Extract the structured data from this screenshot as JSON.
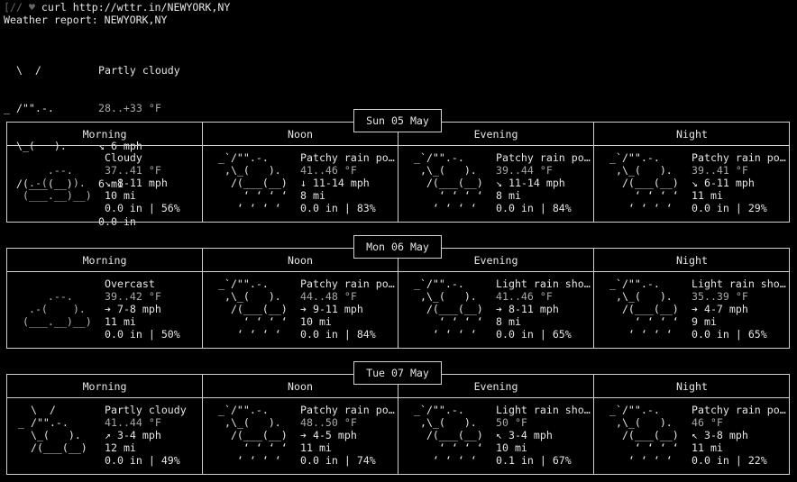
{
  "terminal": {
    "prompt_prefix": "[//",
    "prompt_symbol": "♥",
    "command": "curl http://wttr.in/NEWYORK,NY",
    "report_title": "Weather report: NEWYORK,NY"
  },
  "current": {
    "art": [
      "  \\  /",
      "_ /\"\".-.",
      "  \\_(   ).",
      "  /(___(__)"
    ],
    "condition": "Partly cloudy",
    "temperature": "28..+33 °F",
    "wind_arrow": "↘",
    "wind": "6 mph",
    "visibility": "6 mi",
    "precipitation": "0.0 in"
  },
  "labels": {
    "morning": "Morning",
    "noon": "Noon",
    "evening": "Evening",
    "night": "Night"
  },
  "days": [
    {
      "date": "Sun 05 May",
      "periods": [
        {
          "art": [
            "",
            "     .--.",
            "  .-(    ).",
            " (___.__)__)"
          ],
          "art_type": "cloud",
          "condition": "Cloudy",
          "temp": "37..41 °F",
          "wind_arrow": "↘",
          "wind": "8-11 mph",
          "visibility": "10 mi",
          "precip": "0.0 in | 56%"
        },
        {
          "art": [
            " _`/\"\".-.",
            "  ,\\_(   ).",
            "   /(___(__)",
            "     ʻ ʻ ʻ ʻ",
            "    ʻ ʻ ʻ ʻ"
          ],
          "art_type": "rain",
          "condition": "Patchy rain po…",
          "temp": "41..46 °F",
          "wind_arrow": "↓",
          "wind": "11-14 mph",
          "visibility": "8 mi",
          "precip": "0.0 in | 83%"
        },
        {
          "art": [
            " _`/\"\".-.",
            "  ,\\_(   ).",
            "   /(___(__)",
            "     ʻ ʻ ʻ ʻ",
            "    ʻ ʻ ʻ ʻ"
          ],
          "art_type": "rain",
          "condition": "Patchy rain po…",
          "temp": "39..44 °F",
          "wind_arrow": "↘",
          "wind": "11-14 mph",
          "visibility": "8 mi",
          "precip": "0.0 in | 84%"
        },
        {
          "art": [
            " _`/\"\".-.",
            "  ,\\_(   ).",
            "   /(___(__)",
            "     ʻ ʻ ʻ ʻ",
            "    ʻ ʻ ʻ ʻ"
          ],
          "art_type": "rain",
          "condition": "Patchy rain po…",
          "temp": "39..41 °F",
          "wind_arrow": "↘",
          "wind": "6-11 mph",
          "visibility": "11 mi",
          "precip": "0.0 in | 29%"
        }
      ]
    },
    {
      "date": "Mon 06 May",
      "periods": [
        {
          "art": [
            "",
            "     .--.",
            "  .-(    ).",
            " (___.__)__)"
          ],
          "art_type": "cloud",
          "condition": "Overcast",
          "temp": "39..42 °F",
          "wind_arrow": "➔",
          "wind": "7-8 mph",
          "visibility": "11 mi",
          "precip": "0.0 in | 50%"
        },
        {
          "art": [
            " _`/\"\".-.",
            "  ,\\_(   ).",
            "   /(___(__)",
            "     ʻ ʻ ʻ ʻ",
            "    ʻ ʻ ʻ ʻ"
          ],
          "art_type": "rain",
          "condition": "Patchy rain po…",
          "temp": "44..48 °F",
          "wind_arrow": "➔",
          "wind": "9-11 mph",
          "visibility": "10 mi",
          "precip": "0.0 in | 84%"
        },
        {
          "art": [
            " _`/\"\".-.",
            "  ,\\_(   ).",
            "   /(___(__)",
            "     ʻ ʻ ʻ ʻ",
            "    ʻ ʻ ʻ ʻ"
          ],
          "art_type": "rain",
          "condition": "Light rain sho…",
          "temp": "41..46 °F",
          "wind_arrow": "➔",
          "wind": "8-11 mph",
          "visibility": "8 mi",
          "precip": "0.0 in | 65%"
        },
        {
          "art": [
            " _`/\"\".-.",
            "  ,\\_(   ).",
            "   /(___(__)",
            "     ʻ ʻ ʻ ʻ",
            "    ʻ ʻ ʻ ʻ"
          ],
          "art_type": "rain",
          "condition": "Light rain sho…",
          "temp": "35..39 °F",
          "wind_arrow": "➔",
          "wind": "4-7 mph",
          "visibility": "9 mi",
          "precip": "0.0 in | 65%"
        }
      ]
    },
    {
      "date": "Tue 07 May",
      "periods": [
        {
          "art": [
            "  \\  /",
            "_ /\"\".-.",
            "  \\_(   ).",
            "  /(___(__)"
          ],
          "art_type": "sun",
          "condition": "Partly cloudy",
          "temp": "41..44 °F",
          "wind_arrow": "↗",
          "wind": "3-4 mph",
          "visibility": "12 mi",
          "precip": "0.0 in | 49%"
        },
        {
          "art": [
            " _`/\"\".-.",
            "  ,\\_(   ).",
            "   /(___(__)",
            "     ʻ ʻ ʻ ʻ",
            "    ʻ ʻ ʻ ʻ"
          ],
          "art_type": "rain",
          "condition": "Patchy rain po…",
          "temp": "48..50 °F",
          "wind_arrow": "➔",
          "wind": "4-5 mph",
          "visibility": "11 mi",
          "precip": "0.0 in | 74%"
        },
        {
          "art": [
            " _`/\"\".-.",
            "  ,\\_(   ).",
            "   /(___(__)",
            "     ʻ ʻ ʻ ʻ",
            "    ʻ ʻ ʻ ʻ"
          ],
          "art_type": "rain",
          "condition": "Light rain sho…",
          "temp": "50 °F",
          "wind_arrow": "↖",
          "wind": "3-4 mph",
          "visibility": "10 mi",
          "precip": "0.1 in | 67%"
        },
        {
          "art": [
            " _`/\"\".-.",
            "  ,\\_(   ).",
            "   /(___(__)",
            "     ʻ ʻ ʻ ʻ",
            "    ʻ ʻ ʻ ʻ"
          ],
          "art_type": "rain",
          "condition": "Patchy rain po…",
          "temp": "46 °F",
          "wind_arrow": "↖",
          "wind": "3-8 mph",
          "visibility": "11 mi",
          "precip": "0.0 in | 22%"
        }
      ]
    }
  ]
}
